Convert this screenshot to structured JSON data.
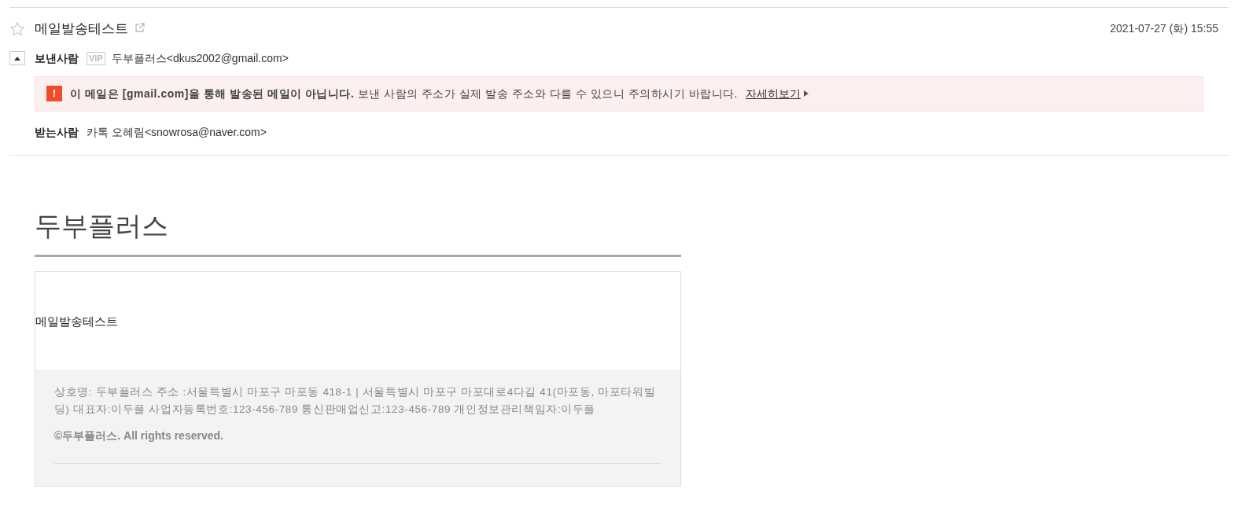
{
  "header": {
    "subject": "메일발송테스트",
    "starred": false,
    "date": "2021-07-27 (화) 15:55"
  },
  "sender": {
    "label": "보낸사람",
    "badge": "VIP",
    "value": "두부플러스<dkus2002@gmail.com>",
    "expanded": true
  },
  "warning": {
    "icon": "!",
    "message": "**이 메일은 [gmail.com]을 통해 발송된 메일이 아닙니다.** 보낸 사람의 주소가 실제 발송 주소와 다를 수 있으니 주의하시기 바랍니다.",
    "link": "자세히보기"
  },
  "recipient": {
    "label": "받는사람",
    "value": "카톡 오혜림<snowrosa@naver.com>"
  },
  "body": {
    "brand": "두부플러스",
    "content": "메일발송테스트",
    "footer_info": "상호명: 두부플러스 주소 :서울특별시 마포구 마포동 418-1 | 서울특별시 마포구 마포대로4다길 41(마포동, 마포타워빌딩) 대표자:이두플 사업자등록번호:123-456-789 통신판매업신고:123-456-789 개인정보관리책임자:이두플",
    "copyright": "©두부플러스. All rights reserved."
  }
}
